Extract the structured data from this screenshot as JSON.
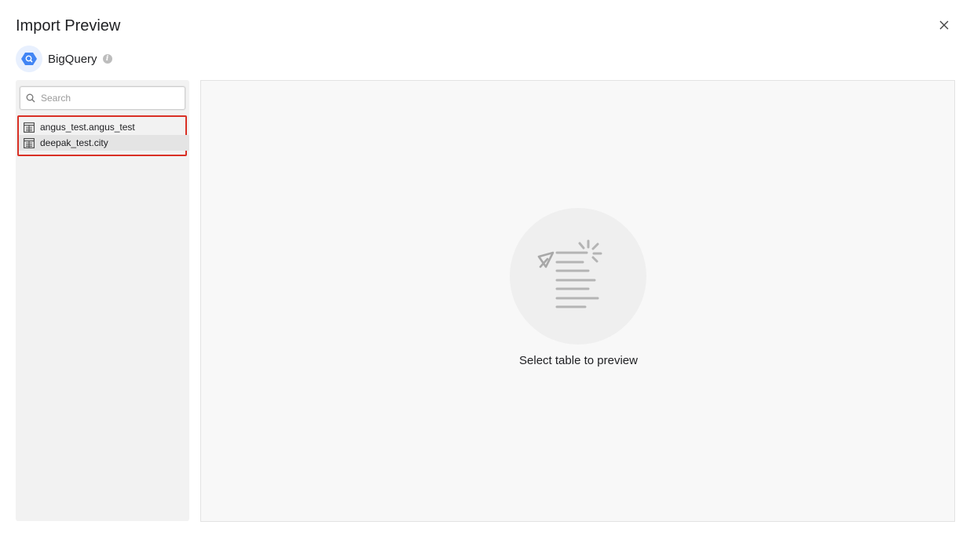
{
  "dialog": {
    "title": "Import Preview"
  },
  "source": {
    "name": "BigQuery",
    "info_icon": "info-icon",
    "logo_icon": "bigquery-logo-icon"
  },
  "search": {
    "placeholder": "Search",
    "value": ""
  },
  "tables": [
    {
      "label": "angus_test.angus_test",
      "icon": "table-icon"
    },
    {
      "label": "deepak_test.city",
      "icon": "table-icon"
    }
  ],
  "preview": {
    "empty_message": "Select table to preview",
    "empty_icon": "document-pointer-icon"
  },
  "colors": {
    "highlight_border": "#d93025",
    "bigquery_blue": "#4285f4"
  }
}
